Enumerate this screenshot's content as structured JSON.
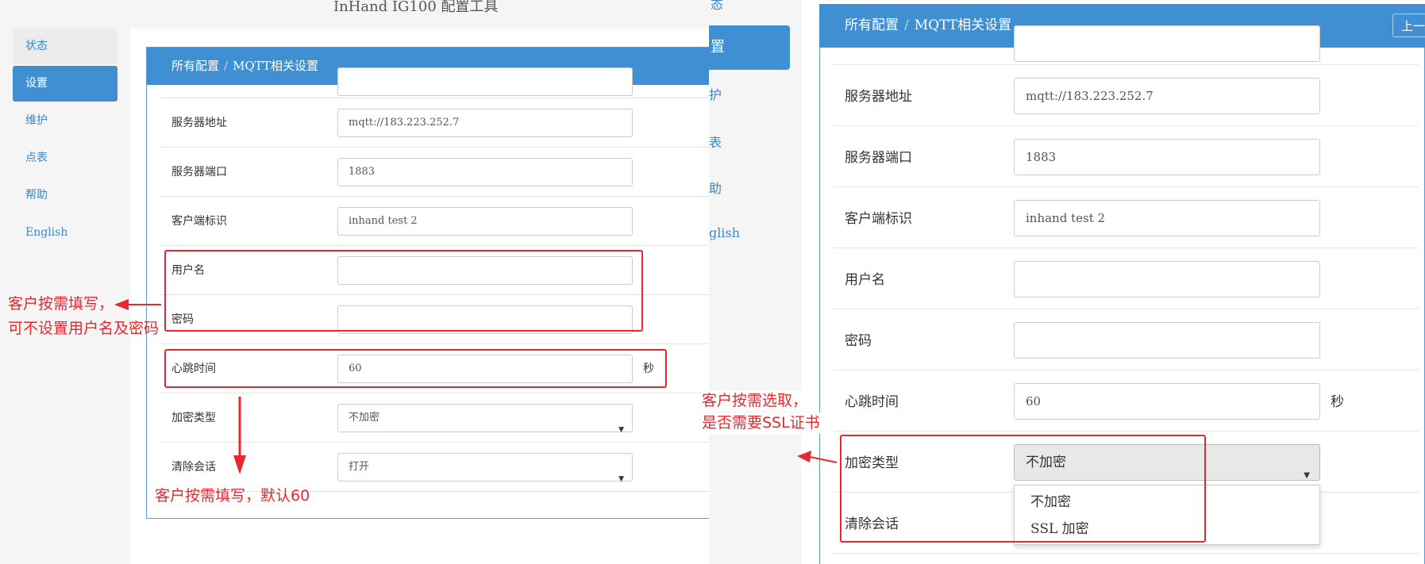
{
  "left": {
    "app_title": "InHand IG100 配置工具",
    "sidebar": [
      "状态",
      "设置",
      "维护",
      "点表",
      "帮助",
      "English"
    ],
    "breadcrumb": [
      "所有配置",
      "MQTT相关设置"
    ],
    "fields": [
      {
        "label": "服务器地址",
        "value": "mqtt://183.223.252.7"
      },
      {
        "label": "服务器端口",
        "value": "1883"
      },
      {
        "label": "客户端标识",
        "value": "inhand test 2"
      },
      {
        "label": "用户名",
        "value": ""
      },
      {
        "label": "密码",
        "value": ""
      },
      {
        "label": "心跳时间",
        "value": "60",
        "unit": "秒"
      },
      {
        "label": "加密类型",
        "value": "不加密"
      },
      {
        "label": "清除会话",
        "value": "打开"
      }
    ]
  },
  "middle": {
    "fragments": [
      "态",
      "置",
      "护",
      "表",
      "助",
      "glish"
    ]
  },
  "right": {
    "breadcrumb": [
      "所有配置",
      "MQTT相关设置"
    ],
    "back_button": "上一级",
    "fields": [
      {
        "label": "服务器地址",
        "value": "mqtt://183.223.252.7"
      },
      {
        "label": "服务器端口",
        "value": "1883"
      },
      {
        "label": "客户端标识",
        "value": "inhand test 2"
      },
      {
        "label": "用户名",
        "value": ""
      },
      {
        "label": "密码",
        "value": ""
      },
      {
        "label": "心跳时间",
        "value": "60",
        "unit": "秒"
      },
      {
        "label": "加密类型",
        "value": "不加密"
      },
      {
        "label": "清除会话",
        "value": ""
      }
    ],
    "dropdown_options": [
      "不加密",
      "SSL 加密"
    ]
  },
  "annotations": {
    "credentials_note_1": "客户按需填写，",
    "credentials_note_2": "可不设置用户名及密码",
    "heartbeat_note": "客户按需填写，默认60",
    "encryption_note_1": "客户按需选取，",
    "encryption_note_2": "是否需要SSL证书"
  },
  "colors": {
    "accent_blue": "#3f8fd2",
    "annotation_red": "#e8282e"
  }
}
